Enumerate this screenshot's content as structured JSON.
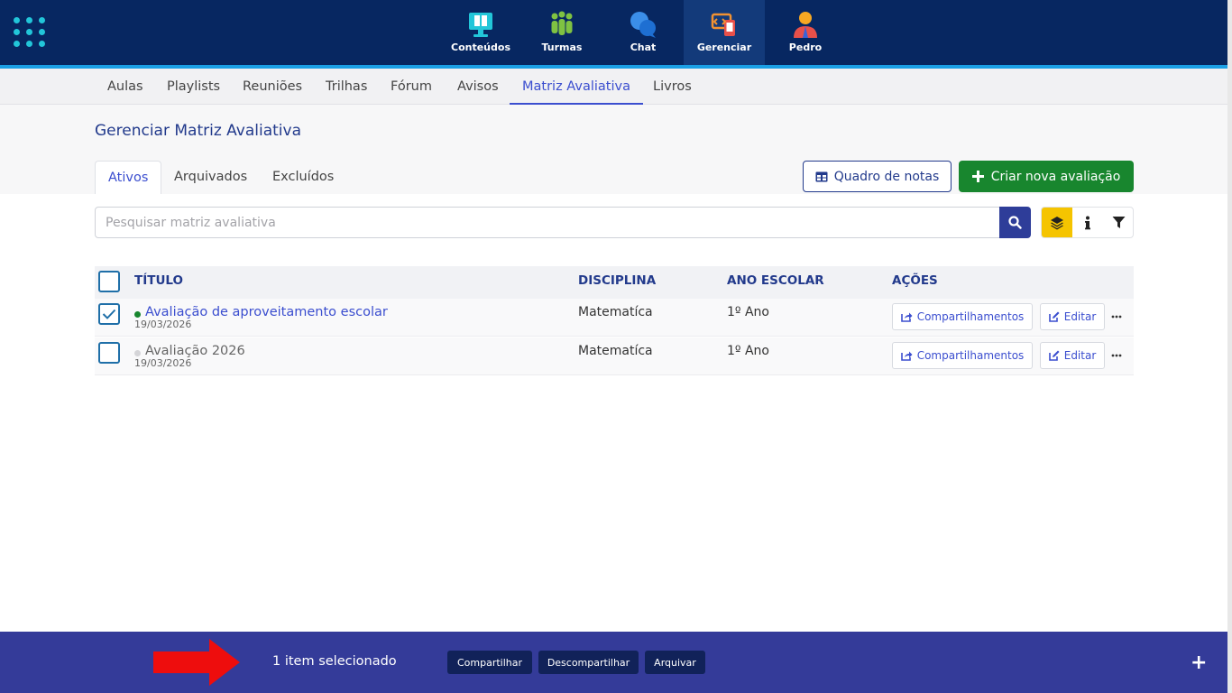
{
  "topnav": {
    "items": [
      {
        "label": "Conteúdos",
        "icon": "monitor-book-icon"
      },
      {
        "label": "Turmas",
        "icon": "people-icon"
      },
      {
        "label": "Chat",
        "icon": "chat-bubbles-icon"
      },
      {
        "label": "Gerenciar",
        "icon": "manage-devices-icon",
        "active": true
      },
      {
        "label": "Pedro",
        "icon": "user-avatar-icon"
      }
    ]
  },
  "subnav": {
    "items": [
      "Aulas",
      "Playlists",
      "Reuniões",
      "Trilhas",
      "Fórum",
      "Avisos",
      "Matriz Avaliativa",
      "Livros"
    ],
    "active": "Matriz Avaliativa"
  },
  "page": {
    "title": "Gerenciar Matriz Avaliativa",
    "tabs": [
      "Ativos",
      "Arquivados",
      "Excluídos"
    ],
    "active_tab": "Ativos",
    "grade_board_label": "Quadro de notas",
    "create_label": "Criar nova avaliação"
  },
  "search": {
    "placeholder": "Pesquisar matriz avaliativa"
  },
  "table": {
    "headers": {
      "title": "TÍTULO",
      "subject": "DISCIPLINA",
      "grade": "ANO ESCOLAR",
      "actions": "AÇÕES"
    },
    "rows": [
      {
        "title": "Avaliação de aproveitamento escolar",
        "date": "19/03/2026",
        "subject": "Matematíca",
        "grade": "1º Ano",
        "checked": true,
        "status": "active"
      },
      {
        "title": "Avaliação 2026",
        "date": "19/03/2026",
        "subject": "Matematíca",
        "grade": "1º Ano",
        "checked": false,
        "status": "inactive"
      }
    ],
    "share_label": "Compartilhamentos",
    "edit_label": "Editar"
  },
  "bottombar": {
    "selected_text": "1 item selecionado",
    "buttons": [
      "Compartilhar",
      "Descompartilhar",
      "Arquivar"
    ]
  },
  "colors": {
    "navbar": "#072761",
    "accent": "#3b4ecf",
    "green": "#18862e",
    "bottombar": "#343b99",
    "highlight": "#f5c400"
  }
}
